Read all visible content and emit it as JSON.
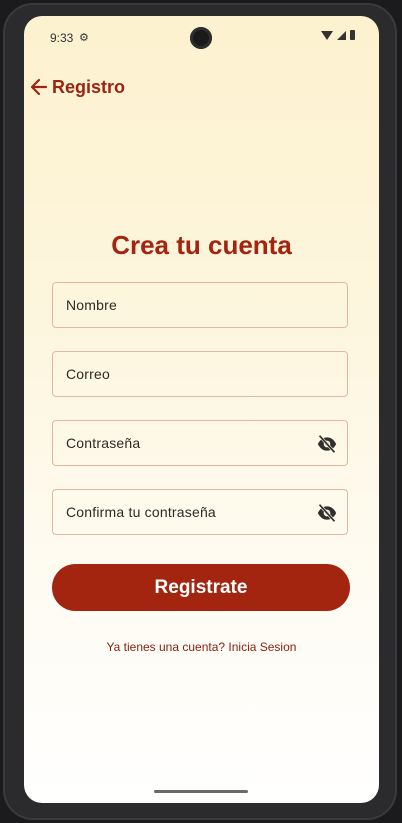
{
  "status_bar": {
    "time": "9:33",
    "settings_icon": "gear-icon",
    "indicators": [
      "wifi-icon",
      "signal-icon",
      "battery-icon"
    ]
  },
  "app_bar": {
    "back_icon": "arrow-left-icon",
    "title": "Registro"
  },
  "form": {
    "heading": "Crea tu cuenta",
    "fields": [
      {
        "label": "Nombre",
        "type": "text"
      },
      {
        "label": "Correo",
        "type": "email"
      },
      {
        "label": "Contraseña",
        "type": "password",
        "icon": "eye-off-icon"
      },
      {
        "label": "Confirma tu contraseña",
        "type": "password",
        "icon": "eye-off-icon"
      }
    ],
    "submit_label": "Registrate",
    "login_link": "Ya tienes una cuenta? Inicia Sesion"
  },
  "colors": {
    "primary": "#a3240f",
    "field_border": "#e4b7a4",
    "background_top": "#fdf2cf",
    "background_bottom": "#ffffff"
  }
}
